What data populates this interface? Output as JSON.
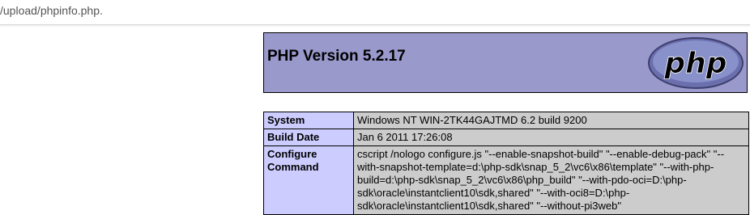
{
  "browser": {
    "url": "/upload/phpinfo.php."
  },
  "header": {
    "title": "PHP Version 5.2.17",
    "logo_text": "php"
  },
  "info": [
    {
      "key": "System",
      "value": "Windows NT WIN-2TK44GAJTMD 6.2 build 9200"
    },
    {
      "key": "Build Date",
      "value": "Jan 6 2011 17:26:08"
    },
    {
      "key": "Configure Command",
      "value": "cscript /nologo configure.js \"--enable-snapshot-build\" \"--enable-debug-pack\" \"--with-snapshot-template=d:\\php-sdk\\snap_5_2\\vc6\\x86\\template\" \"--with-php-build=d:\\php-sdk\\snap_5_2\\vc6\\x86\\php_build\" \"--with-pdo-oci=D:\\php-sdk\\oracle\\instantclient10\\sdk,shared\" \"--with-oci8=D:\\php-sdk\\oracle\\instantclient10\\sdk,shared\" \"--without-pi3web\""
    }
  ],
  "colors": {
    "header_bg": "#9999cc",
    "key_bg": "#ccccff",
    "value_bg": "#cccccc"
  }
}
